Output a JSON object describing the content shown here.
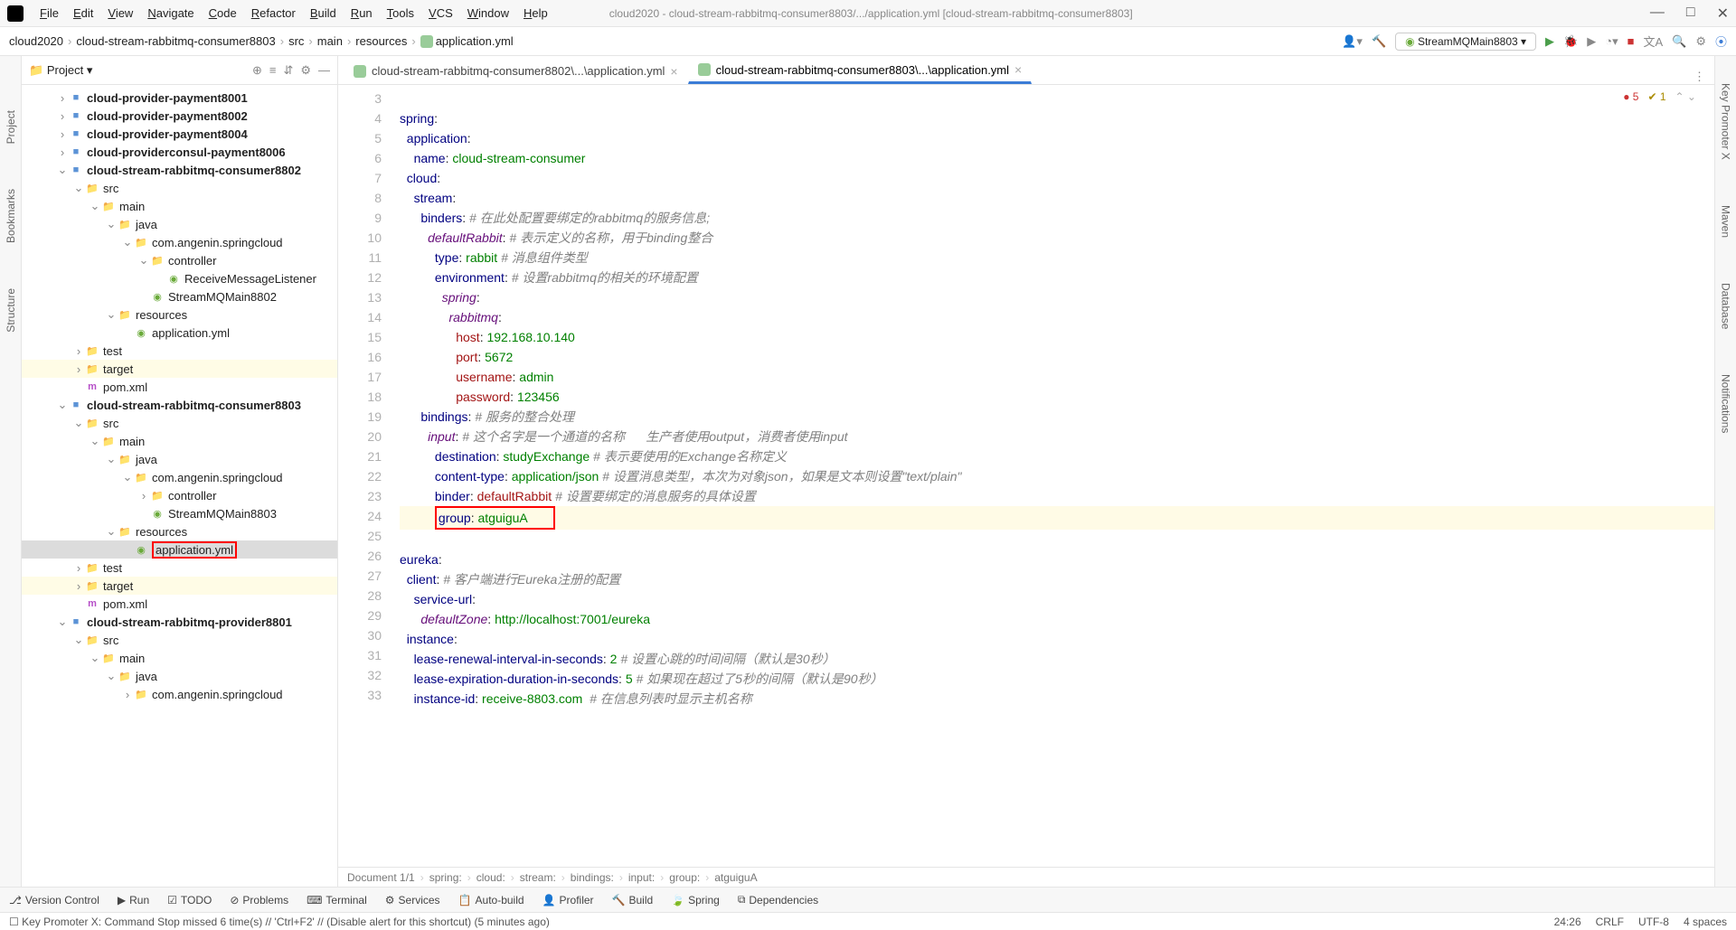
{
  "window": {
    "title": "cloud2020 - cloud-stream-rabbitmq-consumer8803/.../application.yml [cloud-stream-rabbitmq-consumer8803]"
  },
  "menus": [
    "File",
    "Edit",
    "View",
    "Navigate",
    "Code",
    "Refactor",
    "Build",
    "Run",
    "Tools",
    "VCS",
    "Window",
    "Help"
  ],
  "breadcrumb": [
    "cloud2020",
    "cloud-stream-rabbitmq-consumer8803",
    "src",
    "main",
    "resources",
    "application.yml"
  ],
  "run_config": "StreamMQMain8803",
  "sidebar_title": "Project",
  "left_tabs": [
    "Project",
    "Bookmarks",
    "Structure"
  ],
  "right_tabs": [
    "Key Promoter X",
    "Maven",
    "Database",
    "Notifications"
  ],
  "tree": [
    {
      "indent": 1,
      "toggle": ">",
      "ico": "module",
      "label": "cloud-provider-payment8001",
      "bold": true
    },
    {
      "indent": 1,
      "toggle": ">",
      "ico": "module",
      "label": "cloud-provider-payment8002",
      "bold": true
    },
    {
      "indent": 1,
      "toggle": ">",
      "ico": "module",
      "label": "cloud-provider-payment8004",
      "bold": true
    },
    {
      "indent": 1,
      "toggle": ">",
      "ico": "module",
      "label": "cloud-providerconsul-payment8006",
      "bold": true
    },
    {
      "indent": 1,
      "toggle": "v",
      "ico": "module",
      "label": "cloud-stream-rabbitmq-consumer8802",
      "bold": true
    },
    {
      "indent": 2,
      "toggle": "v",
      "ico": "folder",
      "label": "src"
    },
    {
      "indent": 3,
      "toggle": "v",
      "ico": "folder",
      "label": "main"
    },
    {
      "indent": 4,
      "toggle": "v",
      "ico": "folder-b",
      "label": "java"
    },
    {
      "indent": 5,
      "toggle": "v",
      "ico": "folder",
      "label": "com.angenin.springcloud"
    },
    {
      "indent": 6,
      "toggle": "v",
      "ico": "folder",
      "label": "controller"
    },
    {
      "indent": 7,
      "toggle": "",
      "ico": "file-spr",
      "label": "ReceiveMessageListener"
    },
    {
      "indent": 6,
      "toggle": "",
      "ico": "file-spr",
      "label": "StreamMQMain8802"
    },
    {
      "indent": 4,
      "toggle": "v",
      "ico": "folder",
      "label": "resources"
    },
    {
      "indent": 5,
      "toggle": "",
      "ico": "file-spr",
      "label": "application.yml"
    },
    {
      "indent": 2,
      "toggle": ">",
      "ico": "folder",
      "label": "test"
    },
    {
      "indent": 2,
      "toggle": ">",
      "ico": "folder",
      "label": "target",
      "hl": true
    },
    {
      "indent": 2,
      "toggle": "",
      "ico": "file-m",
      "label": "pom.xml"
    },
    {
      "indent": 1,
      "toggle": "v",
      "ico": "module",
      "label": "cloud-stream-rabbitmq-consumer8803",
      "bold": true
    },
    {
      "indent": 2,
      "toggle": "v",
      "ico": "folder",
      "label": "src"
    },
    {
      "indent": 3,
      "toggle": "v",
      "ico": "folder",
      "label": "main"
    },
    {
      "indent": 4,
      "toggle": "v",
      "ico": "folder-b",
      "label": "java"
    },
    {
      "indent": 5,
      "toggle": "v",
      "ico": "folder",
      "label": "com.angenin.springcloud"
    },
    {
      "indent": 6,
      "toggle": ">",
      "ico": "folder",
      "label": "controller"
    },
    {
      "indent": 6,
      "toggle": "",
      "ico": "file-spr",
      "label": "StreamMQMain8803"
    },
    {
      "indent": 4,
      "toggle": "v",
      "ico": "folder",
      "label": "resources"
    },
    {
      "indent": 5,
      "toggle": "",
      "ico": "file-spr",
      "label": "application.yml",
      "sel": true,
      "red": true
    },
    {
      "indent": 2,
      "toggle": ">",
      "ico": "folder",
      "label": "test"
    },
    {
      "indent": 2,
      "toggle": ">",
      "ico": "folder",
      "label": "target",
      "hl": true
    },
    {
      "indent": 2,
      "toggle": "",
      "ico": "file-m",
      "label": "pom.xml"
    },
    {
      "indent": 1,
      "toggle": "v",
      "ico": "module",
      "label": "cloud-stream-rabbitmq-provider8801",
      "bold": true
    },
    {
      "indent": 2,
      "toggle": "v",
      "ico": "folder",
      "label": "src"
    },
    {
      "indent": 3,
      "toggle": "v",
      "ico": "folder",
      "label": "main"
    },
    {
      "indent": 4,
      "toggle": "v",
      "ico": "folder-b",
      "label": "java"
    },
    {
      "indent": 5,
      "toggle": ">",
      "ico": "folder",
      "label": "com.angenin.springcloud"
    }
  ],
  "editor_tabs": [
    {
      "label": "cloud-stream-rabbitmq-consumer8802\\...\\application.yml",
      "active": false
    },
    {
      "label": "cloud-stream-rabbitmq-consumer8803\\...\\application.yml",
      "active": true
    }
  ],
  "problems": {
    "errors": "5",
    "warnings": "1"
  },
  "code_lines": [
    {
      "n": 3,
      "html": ""
    },
    {
      "n": 4,
      "html": "<span class='k'>spring</span>:"
    },
    {
      "n": 5,
      "html": "  <span class='k'>application</span>:"
    },
    {
      "n": 6,
      "html": "    <span class='k'>name</span>: <span class='v'>cloud-stream-consumer</span>"
    },
    {
      "n": 7,
      "html": "  <span class='k'>cloud</span>:"
    },
    {
      "n": 8,
      "html": "    <span class='k'>stream</span>:"
    },
    {
      "n": 9,
      "html": "      <span class='k'>binders</span>: <span class='c'># 在此处配置要绑定的rabbitmq的服务信息;</span>"
    },
    {
      "n": 10,
      "html": "        <span class='it'>defaultRabbit</span>: <span class='c'># 表示定义的名称，用于binding整合</span>"
    },
    {
      "n": 11,
      "html": "          <span class='k'>type</span>: <span class='v'>rabbit</span> <span class='c'># 消息组件类型</span>"
    },
    {
      "n": 12,
      "html": "          <span class='k'>environment</span>: <span class='c'># 设置rabbitmq的相关的环境配置</span>"
    },
    {
      "n": 13,
      "html": "            <span class='it'>spring</span>:"
    },
    {
      "n": 14,
      "html": "              <span class='it'>rabbitmq</span>:"
    },
    {
      "n": 15,
      "html": "                <span class='red'>host</span>: <span class='v'>192.168.10.140</span>"
    },
    {
      "n": 16,
      "html": "                <span class='red'>port</span>: <span class='v'>5672</span>"
    },
    {
      "n": 17,
      "html": "                <span class='red'>username</span>: <span class='v'>admin</span>"
    },
    {
      "n": 18,
      "html": "                <span class='red'>password</span>: <span class='v'>123456</span>"
    },
    {
      "n": 19,
      "html": "      <span class='k'>bindings</span>: <span class='c'># 服务的整合处理</span>"
    },
    {
      "n": 20,
      "html": "        <span class='it'>input</span>: <span class='c'># 这个名字是一个通道的名称      生产者使用output，消费者使用input</span>"
    },
    {
      "n": 21,
      "html": "          <span class='k'>destination</span>: <span class='v'>studyExchange</span> <span class='c'># 表示要使用的Exchange名称定义</span>"
    },
    {
      "n": 22,
      "html": "          <span class='k'>content-type</span>: <span class='v'>application/json</span> <span class='c'># 设置消息类型，本次为对象json，如果是文本则设置\"text/plain\"</span>"
    },
    {
      "n": 23,
      "html": "          <span class='k'>binder</span>: <span class='red'>defaultRabbit</span> <span class='c'># 设置要绑定的消息服务的具体设置</span>"
    },
    {
      "n": 24,
      "cur": true,
      "html": "          <span class='redframe'><span class='k'>group</span>: <span class='v'>atguiguA</span>       </span>"
    },
    {
      "n": 25,
      "html": ""
    },
    {
      "n": 26,
      "html": "<span class='k'>eureka</span>:"
    },
    {
      "n": 27,
      "html": "  <span class='k'>client</span>: <span class='c'># 客户端进行Eureka注册的配置</span>"
    },
    {
      "n": 28,
      "html": "    <span class='k'>service-url</span>:"
    },
    {
      "n": 29,
      "html": "      <span class='it'>defaultZone</span>: <span class='v'>http://localhost:7001/eureka</span>"
    },
    {
      "n": 30,
      "html": "  <span class='k'>instance</span>:"
    },
    {
      "n": 31,
      "html": "    <span class='k'>lease-renewal-interval-in-seconds</span>: <span class='v'>2</span> <span class='c'># 设置心跳的时间间隔（默认是30秒）</span>"
    },
    {
      "n": 32,
      "html": "    <span class='k'>lease-expiration-duration-in-seconds</span>: <span class='v'>5</span> <span class='c'># 如果现在超过了5秒的间隔（默认是90秒）</span>"
    },
    {
      "n": 33,
      "html": "    <span class='k'>instance-id</span>: <span class='v'>receive-8803.com</span>  <span class='c'># 在信息列表时显示主机名称</span>"
    }
  ],
  "crumbs2": [
    "Document 1/1",
    "spring:",
    "cloud:",
    "stream:",
    "bindings:",
    "input:",
    "group:",
    "atguiguA"
  ],
  "toolwindows": [
    "Version Control",
    "Run",
    "TODO",
    "Problems",
    "Terminal",
    "Services",
    "Auto-build",
    "Profiler",
    "Build",
    "Spring",
    "Dependencies"
  ],
  "status_msg": "Key Promoter X: Command Stop missed 6 time(s) // 'Ctrl+F2' // (Disable alert for this shortcut) (5 minutes ago)",
  "status_right": [
    "24:26",
    "CRLF",
    "UTF-8",
    "4 spaces"
  ]
}
